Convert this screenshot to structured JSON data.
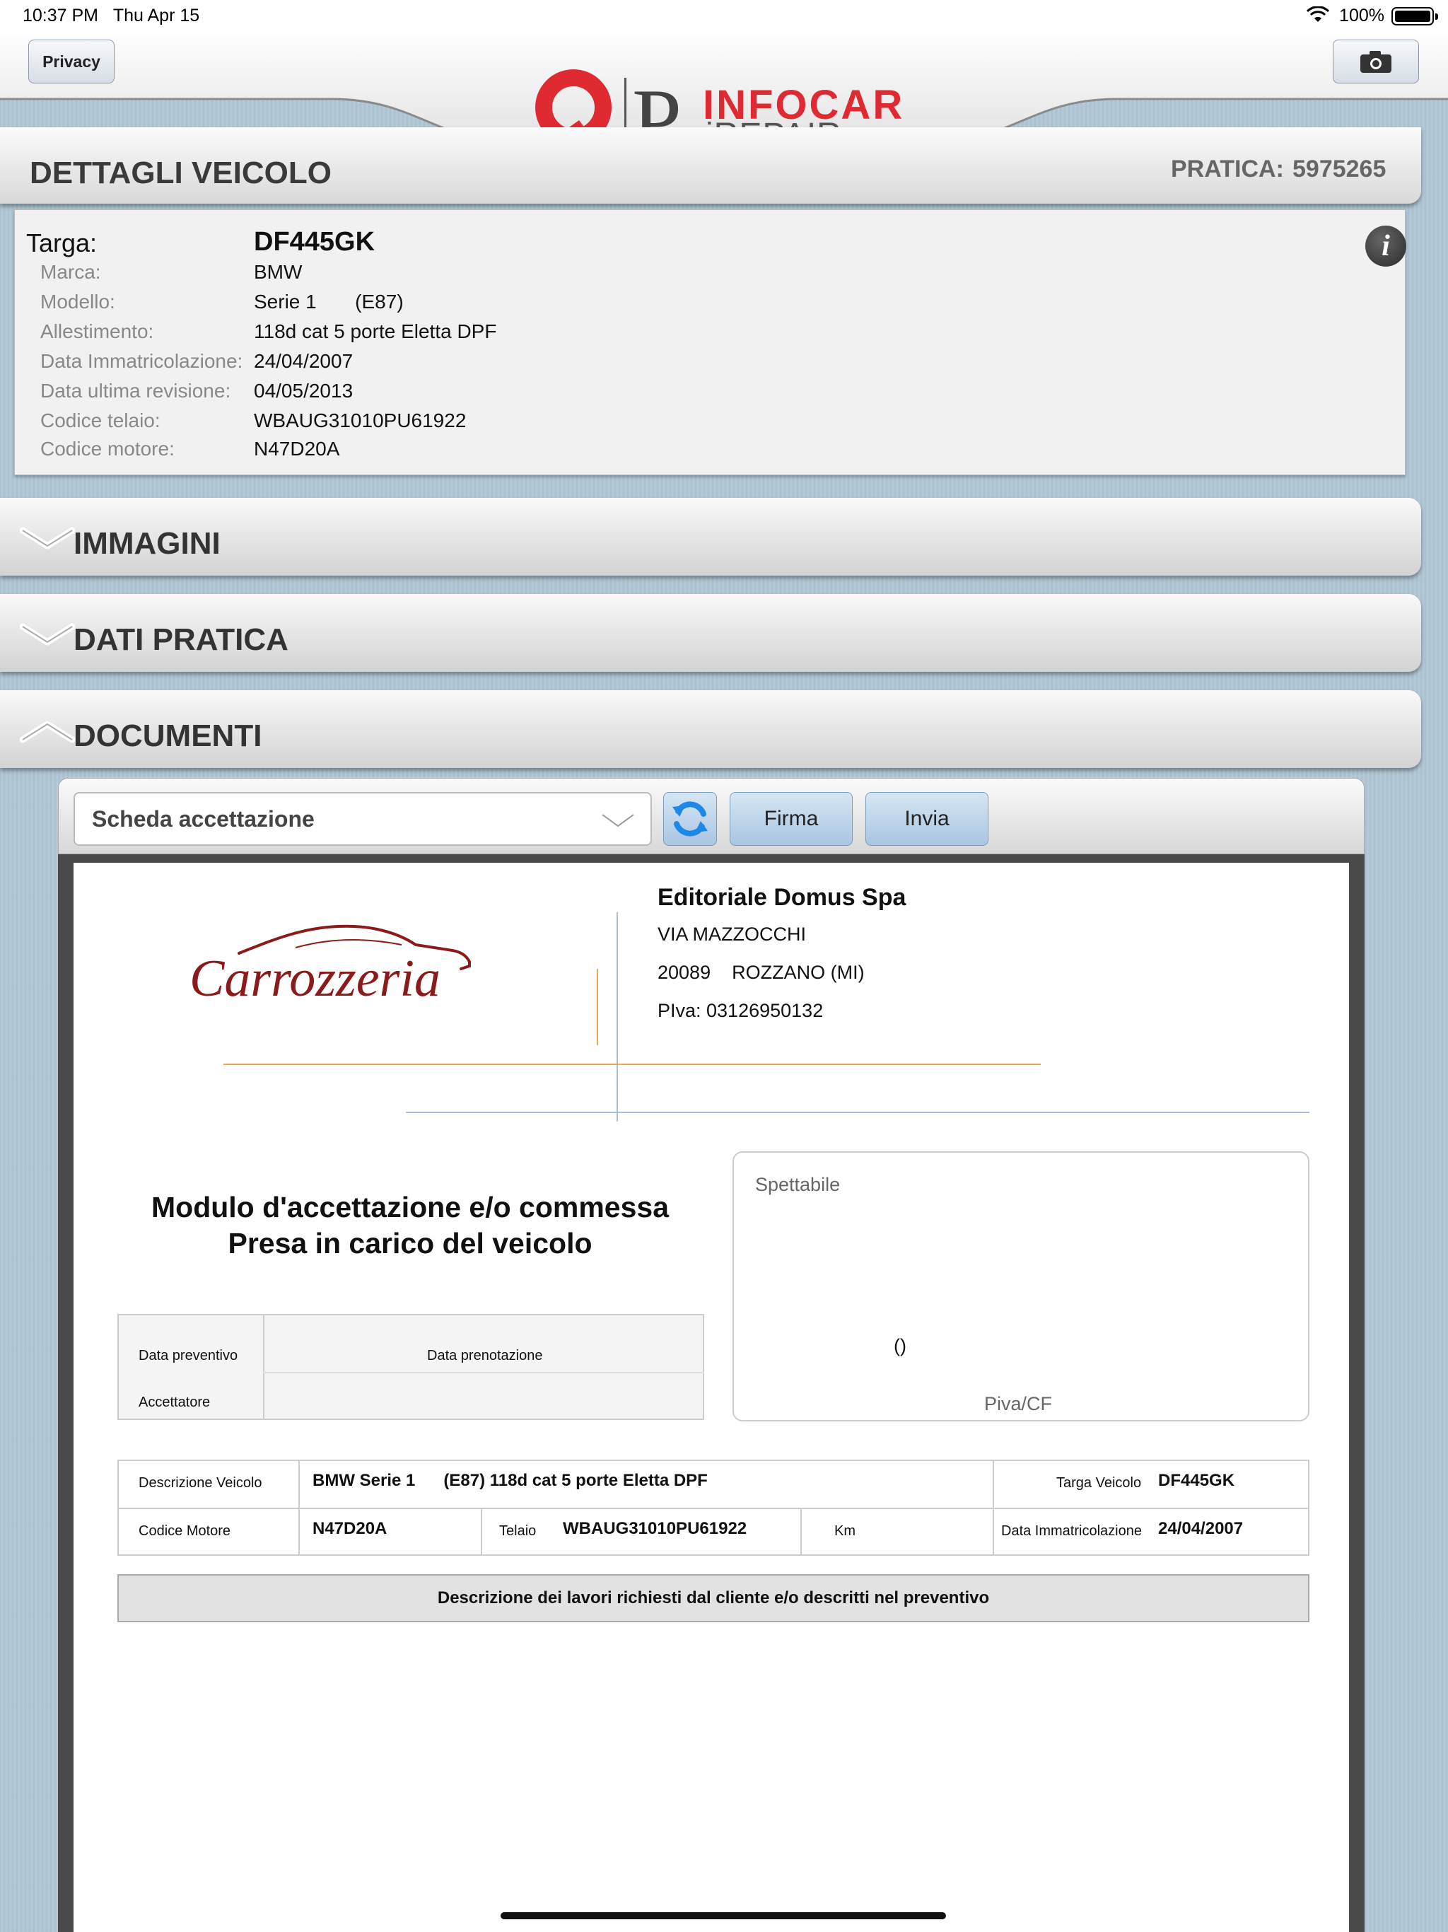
{
  "status_bar": {
    "time": "10:37 PM",
    "date": "Thu Apr 15",
    "battery": "100%"
  },
  "header": {
    "privacy_label": "Privacy",
    "logo": {
      "brand_top": "INFOCAR",
      "brand_bottom": "iREPAIR",
      "letter": "P"
    },
    "title": "DETTAGLI VEICOLO",
    "pratica_label": "PRATICA:",
    "pratica_value": "5975265"
  },
  "vehicle": {
    "targa_label": "Targa:",
    "targa_value": "DF445GK",
    "rows": [
      {
        "label": "Marca:",
        "value": "BMW"
      },
      {
        "label": "Modello:",
        "value": "Serie 1       (E87)"
      },
      {
        "label": "Allestimento:",
        "value": "118d cat 5 porte Eletta DPF"
      },
      {
        "label": "Data Immatricolazione:",
        "value": "24/04/2007"
      },
      {
        "label": "Data ultima revisione:",
        "value": "04/05/2013"
      },
      {
        "label": "Codice telaio:",
        "value": "WBAUG31010PU61922"
      },
      {
        "label": "Codice motore:",
        "value": "N47D20A"
      }
    ]
  },
  "sections": {
    "immagini": {
      "label": "IMMAGINI",
      "state": "collapsed"
    },
    "dati_pratica": {
      "label": "DATI PRATICA",
      "state": "collapsed"
    },
    "documenti": {
      "label": "DOCUMENTI",
      "state": "expanded"
    }
  },
  "documents_toolbar": {
    "selected_document": "Scheda accettazione",
    "firma_label": "Firma",
    "invia_label": "Invia"
  },
  "document": {
    "logo_text": "Carrozzeria",
    "company": {
      "name": "Editoriale Domus Spa",
      "address": "VIA MAZZOCCHI",
      "cap": "20089",
      "city": "ROZZANO (MI)",
      "piva": "PIva: 03126950132"
    },
    "title_line1": "Modulo d'accettazione e/o commessa",
    "title_line2": "Presa in carico del veicolo",
    "spettabile": {
      "label": "Spettabile",
      "paren": "()",
      "piva_label": "Piva/CF"
    },
    "dates_table": {
      "data_preventivo": "Data preventivo",
      "data_prenotazione": "Data prenotazione",
      "accettatore": "Accettatore"
    },
    "vehicle_table": {
      "descrizione_label": "Descrizione Veicolo",
      "descrizione_value": "BMW Serie 1      (E87) 118d cat 5 porte Eletta DPF",
      "targa_label": "Targa Veicolo",
      "targa_value": "DF445GK",
      "motore_label": "Codice Motore",
      "motore_value": "N47D20A",
      "telaio_label": "Telaio",
      "telaio_value": "WBAUG31010PU61922",
      "km_label": "Km",
      "immatricolazione_label": "Data Immatricolazione",
      "immatricolazione_value": "24/04/2007"
    },
    "lavori_header": "Descrizione dei lavori richiesti dal cliente e/o descritti nel preventivo"
  },
  "colors": {
    "brand_red": "#e02a31",
    "background": "#a9c0cf",
    "button_blue": "#a9c5e1",
    "refresh_blue": "#1e88e5"
  }
}
